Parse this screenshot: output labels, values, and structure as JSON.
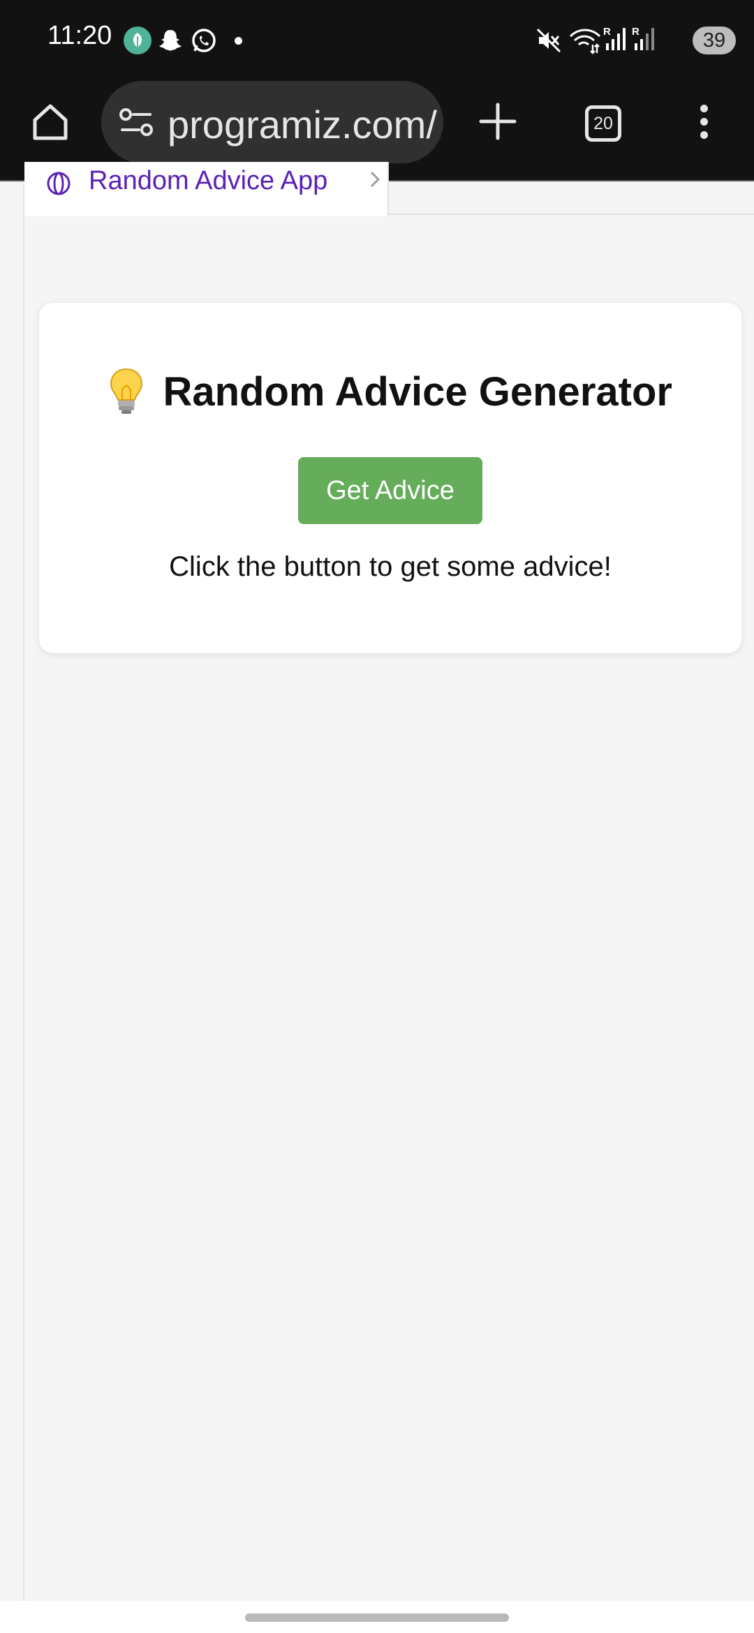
{
  "status_bar": {
    "time": "11:20",
    "battery": "39",
    "notification_icons": [
      "leaf-app-icon",
      "snapchat-icon",
      "whatsapp-icon"
    ],
    "system_icons": [
      "mute-icon",
      "wifi-icon",
      "signal-r-icon",
      "signal-r-icon"
    ]
  },
  "browser": {
    "url": "programiz.com/",
    "tab_count": "20"
  },
  "page": {
    "file_tab_label": "Random Advice App",
    "card": {
      "title": "Random Advice Generator",
      "button_label": "Get Advice",
      "advice_text": "Click the button to get some advice!"
    }
  },
  "colors": {
    "status_bg": "#121212",
    "button_green": "#66ad5b",
    "tab_label_purple": "#5b21b6",
    "page_bg": "#f5f5f5"
  }
}
